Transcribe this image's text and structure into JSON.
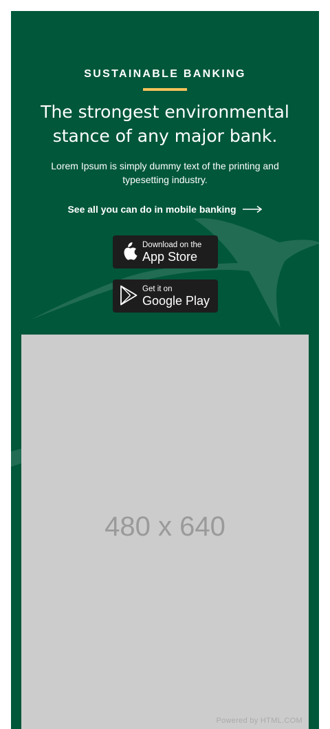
{
  "hero": {
    "eyebrow": "SUSTAINABLE BANKING",
    "headline_line1": "The strongest environmental",
    "headline_line2": "stance of any major bank.",
    "subtext_line1": "Lorem Ipsum is simply dummy text of the printing and",
    "subtext_line2": "typesetting industry.",
    "link_label": "See all you can do in mobile banking",
    "link_icon": "arrow-right-icon"
  },
  "app_store": {
    "small": "Download on the",
    "big": "App Store",
    "icon": "apple-icon"
  },
  "google_play": {
    "small": "Get it on",
    "big": "Google Play",
    "icon": "play-icon"
  },
  "image_placeholder": {
    "label": "480 x 640",
    "credit": "Powered by HTML.COM"
  },
  "colors": {
    "background": "#00573a",
    "accent": "#f5c25b",
    "button": "#1d1d1d",
    "placeholder": "#cccccc"
  }
}
